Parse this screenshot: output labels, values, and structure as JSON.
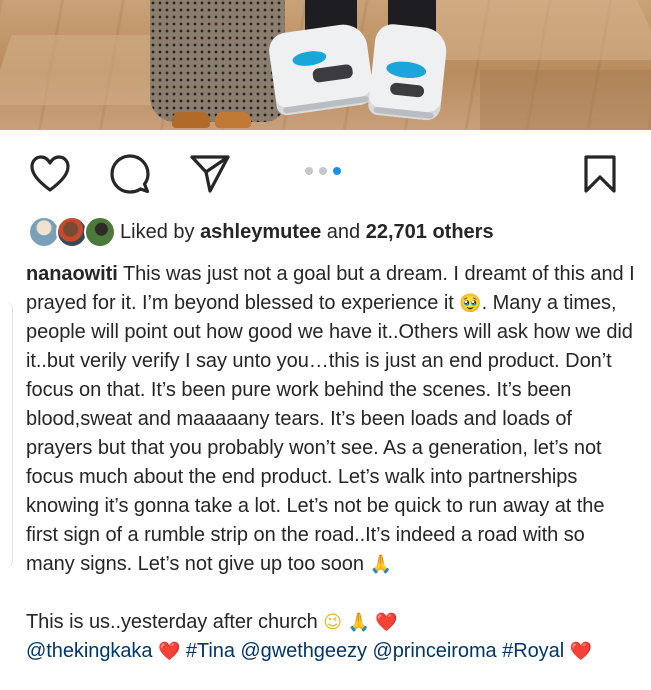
{
  "post": {
    "photo_alt": "Couple photo showing feet and sneakers on paved ground",
    "carousel": {
      "total": 3,
      "active": 3
    },
    "likes": {
      "prefix": "Liked by ",
      "user": "ashleymutee",
      "middle": " and ",
      "count": "22,701 others"
    },
    "caption": {
      "username": "nanaowiti",
      "body": "This was just not a goal but a dream. I dreamt of this and I prayed for it. I’m beyond blessed to experience it ",
      "emoji_tear": "🥹",
      "body2": ". Many a times, people will point out how good we have it..Others will ask how we did it..but verily verify I say unto you…this is just an end product. Don’t focus on that. It’s been pure work behind the scenes. It’s been blood,sweat and maaaaany tears. It’s been loads and loads of prayers but that you probably won’t see. As a generation, let’s not focus much about the end product. Let’s walk into partnerships knowing it’s gonna take a lot. Let’s not be quick to run away at the first sign of a rumble strip on the road..It’s indeed a road with so many signs. Let’s not give up too soon ",
      "emoji_pray": "🙏",
      "line2_text": "This is us..yesterday after church ",
      "line2_wink": "😉",
      "line2_pray": "🙏",
      "line2_heart": "❤️",
      "tag1": "@thekingkaka",
      "heart1": "❤️",
      "tag2": "#Tina",
      "tag3": "@gwethgeezy",
      "tag4": "@princeiroma",
      "tag5": "#Royal",
      "heart2": "❤️"
    }
  },
  "icons": {
    "like": "heart-outline-icon",
    "comment": "speech-bubble-icon",
    "share": "paper-plane-icon",
    "save": "bookmark-icon"
  },
  "colors": {
    "text": "#262626",
    "link": "#00376b",
    "carousel_active": "#1a8ff0",
    "carousel_inactive": "#c7c7c7"
  }
}
